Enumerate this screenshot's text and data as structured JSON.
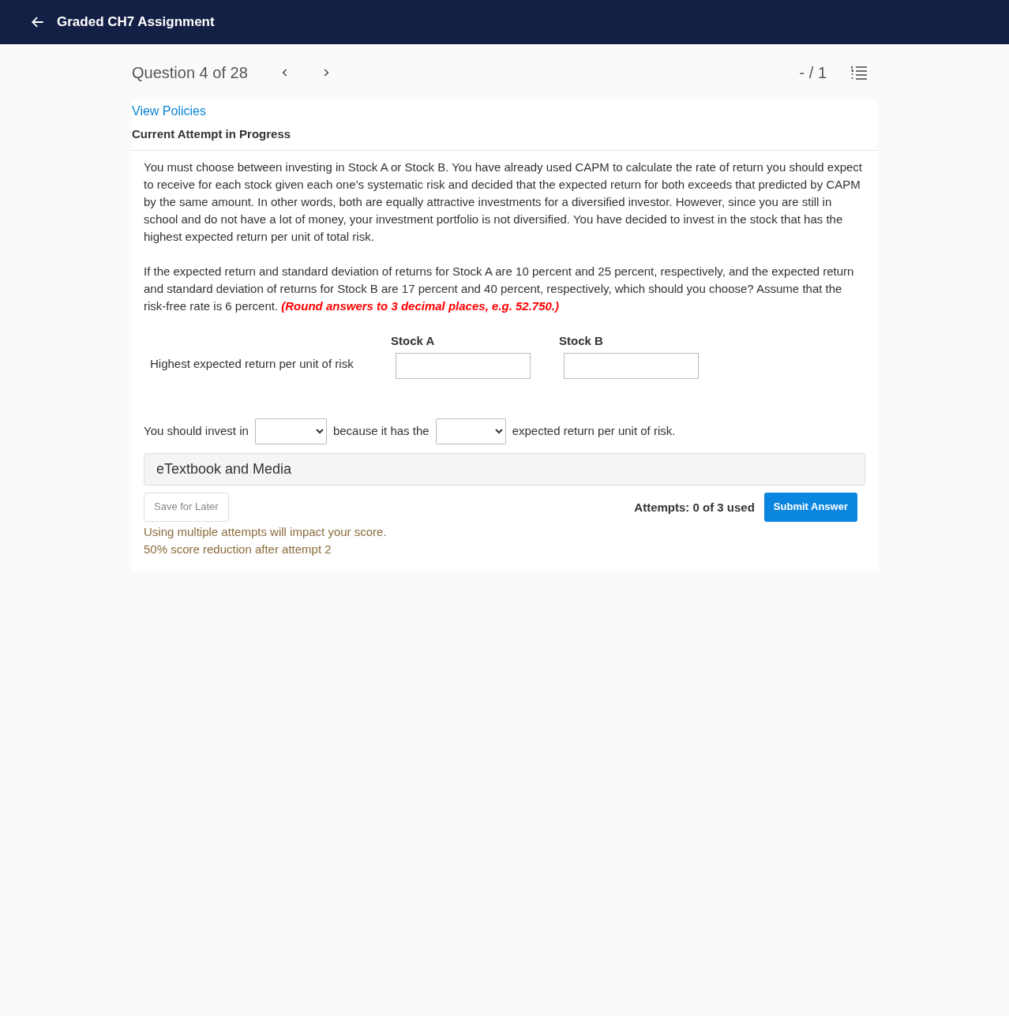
{
  "header": {
    "title": "Graded CH7 Assignment"
  },
  "question_bar": {
    "label": "Question 4 of 28",
    "score": "- / 1"
  },
  "policies_link": "View Policies",
  "attempt_status": "Current Attempt in Progress",
  "paragraphs": [
    "You must choose between investing in Stock A or Stock B. You have already used CAPM to calculate the rate of return you should expect to receive for each stock given each one’s systematic risk and decided that the expected return for both exceeds that predicted by CAPM by the same amount. In other words, both are equally attractive investments for a diversified investor. However, since you are still in school and do not have a lot of money, your investment portfolio is not diversified. You have decided to invest in the stock that has the highest expected return per unit of total risk.",
    "If the expected return and standard deviation of returns for Stock A are 10 percent and 25 percent, respectively, and the expected return and standard deviation of returns for Stock B are 17 percent and 40 percent, respectively, which should you choose? Assume that the risk-free rate is 6 percent."
  ],
  "instruction": "(Round answers to 3 decimal places, e.g. 52.750.)",
  "answer_table": {
    "columns": [
      "Stock A",
      "Stock B"
    ],
    "row_label": "Highest expected return per unit of risk"
  },
  "sentence": [
    "You should invest in",
    "because it has the",
    "expected return per unit of risk."
  ],
  "etextbook": "eTextbook and Media",
  "save_button": "Save for Later",
  "attempts": "Attempts: 0 of 3 used",
  "submit_button": "Submit Answer",
  "warnings": [
    "Using multiple attempts will impact your score.",
    "50% score reduction after attempt 2"
  ]
}
